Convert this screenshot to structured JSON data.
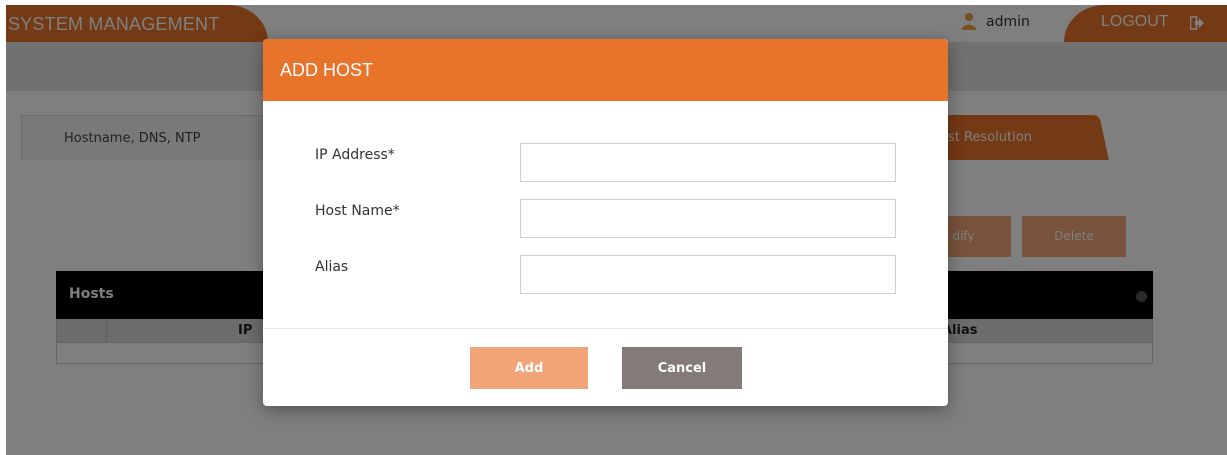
{
  "app": {
    "title": "SYSTEM MANAGEMENT",
    "user": "admin",
    "logout_label": "LOGOUT"
  },
  "tabs": [
    {
      "label": "Hostname, DNS, NTP",
      "active": false
    },
    {
      "label": "ost Resolution",
      "active": true
    }
  ],
  "actions": {
    "modify_label": "dify",
    "delete_label": "Delete"
  },
  "grid": {
    "title": "Hosts",
    "columns": [
      "IP",
      "Alias"
    ],
    "rows": []
  },
  "modal": {
    "title": "ADD HOST",
    "fields": [
      {
        "label": "IP Address*",
        "value": "",
        "placeholder": ""
      },
      {
        "label": "Host Name*",
        "value": "",
        "placeholder": ""
      },
      {
        "label": "Alias",
        "value": "",
        "placeholder": ""
      }
    ],
    "add_label": "Add",
    "cancel_label": "Cancel"
  },
  "colors": {
    "accent": "#e8732b",
    "accent_muted": "#f1a478",
    "cancel": "#847b79",
    "grid_header": "#000000"
  },
  "icons": {
    "user": "user-icon",
    "logout": "logout-icon",
    "settings": "gear-icon"
  }
}
